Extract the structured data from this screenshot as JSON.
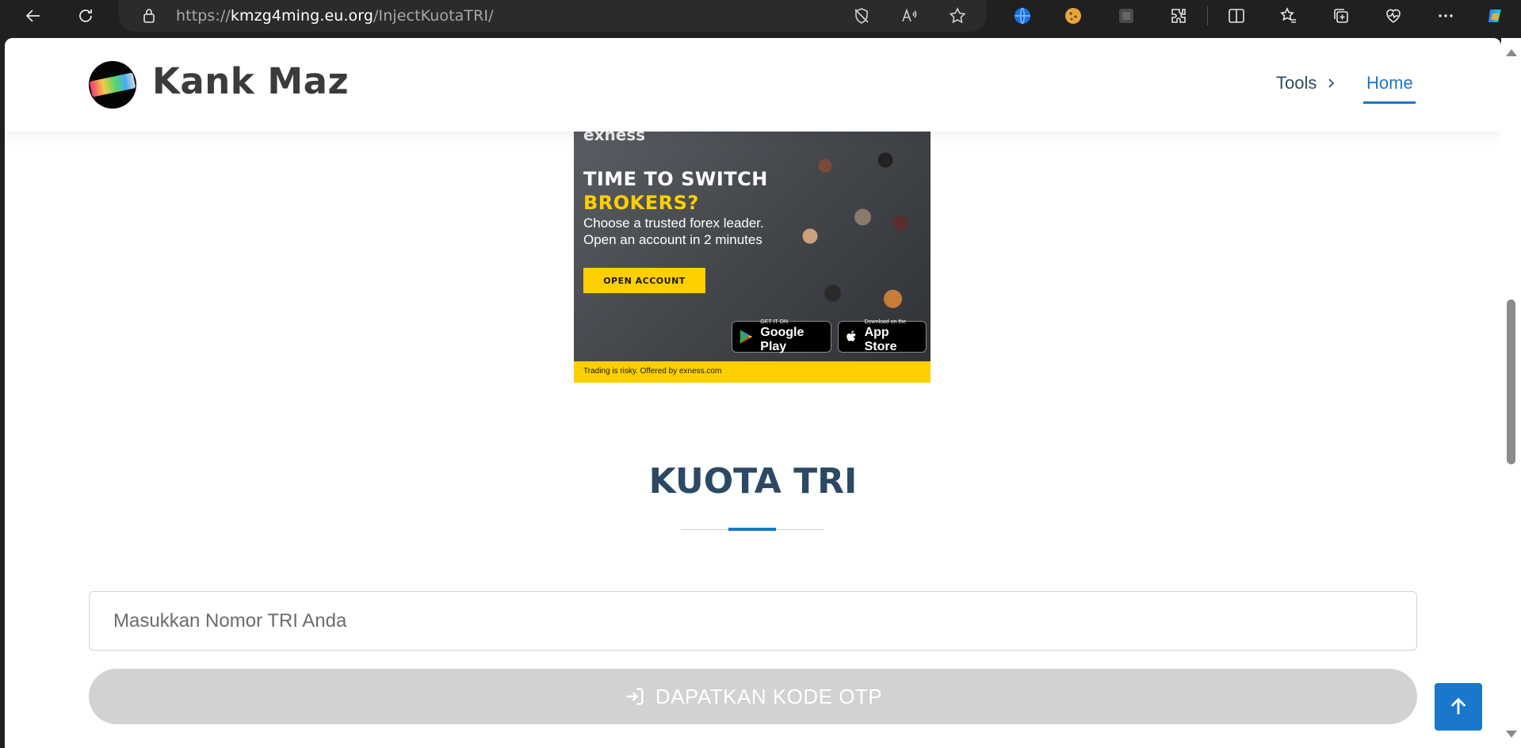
{
  "browser": {
    "url_prefix": "https://",
    "url_host": "kmzg4ming.eu.org",
    "url_path": "/InjectKuotaTRI/"
  },
  "site": {
    "name": "Kank Maz",
    "nav": {
      "tools_label": "Tools",
      "home_label": "Home"
    }
  },
  "ad": {
    "brand": "exness",
    "headline_1": "TIME TO SWITCH",
    "headline_2": "BROKERS?",
    "sub_1": "Choose a trusted forex leader.",
    "sub_2": "Open an account in 2 minutes",
    "cta": "OPEN ACCOUNT",
    "google_play_small": "GET IT ON",
    "google_play_big": "Google Play",
    "app_store_small": "Download on the",
    "app_store_big": "App Store",
    "footer": "Trading is risky. Offered by exness.com"
  },
  "section": {
    "title": "KUOTA TRI"
  },
  "form": {
    "phone_placeholder": "Masukkan Nomor TRI Anda",
    "phone_value": "",
    "submit_label": "DAPATKAN KODE OTP"
  },
  "colors": {
    "accent": "#1977cc",
    "title": "#2c4964",
    "button_disabled": "#d2d2d2",
    "ad_yellow": "#ffcf00"
  }
}
